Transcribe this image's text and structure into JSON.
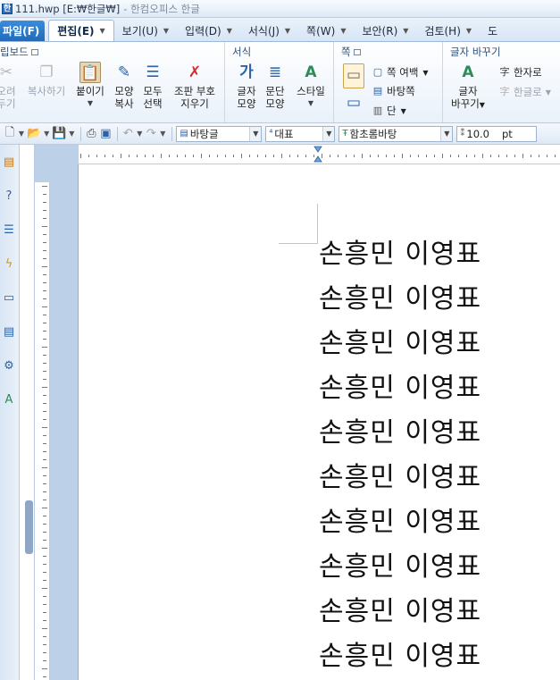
{
  "window": {
    "title": "111.hwp [E:₩한글₩]",
    "app_name": "- 한컴오피스 한글"
  },
  "menu": {
    "file": "파일(F)",
    "tabs": [
      "편집(E)",
      "보기(U)",
      "입력(D)",
      "서식(J)",
      "쪽(W)",
      "보안(R)",
      "검토(H)",
      "도"
    ]
  },
  "ribbon": {
    "clipboard": {
      "title": "립보드",
      "cut": [
        "오려",
        "두기"
      ],
      "copy": "복사하기",
      "paste": "붙이기",
      "format_copy": [
        "모양",
        "복사"
      ],
      "select_all": [
        "모두",
        "선택"
      ],
      "clear_symbols": [
        "조판 부호",
        "지우기"
      ]
    },
    "format": {
      "title": "서식",
      "char_shape": [
        "글자",
        "모양"
      ],
      "para_shape": [
        "문단",
        "모양"
      ],
      "style": "스타일"
    },
    "page": {
      "title": "쪽",
      "margin": "쪽 여백",
      "master_page": "바탕쪽",
      "columns": "단"
    },
    "convert": {
      "title": "글자 바꾸기",
      "char_convert": [
        "글자",
        "바꾸기"
      ],
      "to_hanja": "한자로",
      "to_hangul": "한글로"
    }
  },
  "toolbar": {
    "style_combo": "바탕글",
    "lang_combo": "대표",
    "font_combo": "함초롬바탕",
    "size_value": "10.0",
    "size_unit": "pt"
  },
  "document": {
    "lines": [
      "손흥민 이영표",
      "손흥민 이영표",
      "손흥민 이영표",
      "손흥민 이영표",
      "손흥민 이영표",
      "손흥민 이영표",
      "손흥민 이영표",
      "손흥민 이영표",
      "손흥민 이영표",
      "손흥민 이영표"
    ]
  },
  "colors": {
    "accent": "#1f6bbd",
    "ribbon_bg": "#e9f1fa",
    "ruler_margin": "#bcd0e8"
  },
  "icons": [
    "cut-icon",
    "copy-icon",
    "paste-icon",
    "format-copy-icon",
    "select-all-icon",
    "clear-symbols-icon",
    "char-shape-icon",
    "para-shape-icon",
    "style-icon",
    "page-margin-icon",
    "master-page-icon",
    "columns-icon",
    "char-convert-icon",
    "hanja-icon",
    "hangul-icon",
    "new-doc-icon",
    "open-icon",
    "save-icon",
    "print-icon",
    "preview-icon",
    "undo-icon",
    "redo-icon"
  ]
}
